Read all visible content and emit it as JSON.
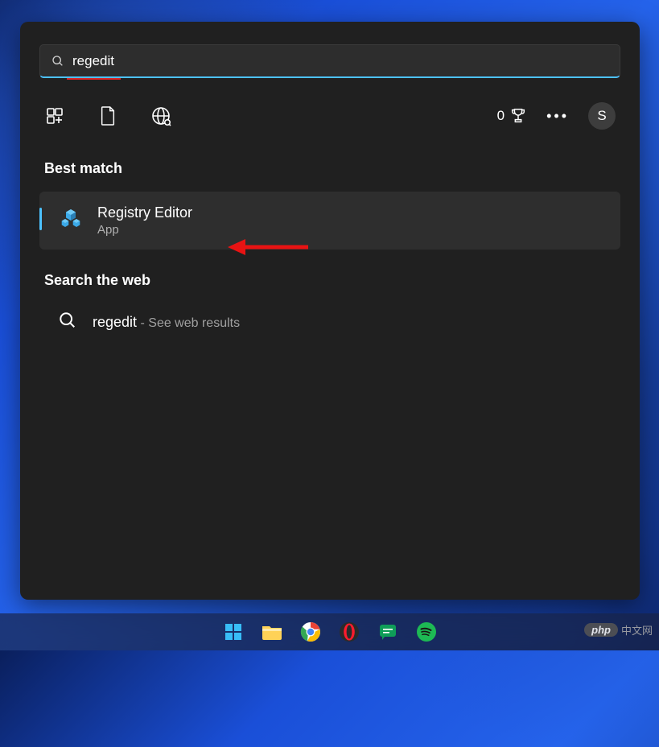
{
  "search": {
    "value": "regedit"
  },
  "rewards": {
    "points": "0"
  },
  "avatar": {
    "initial": "S"
  },
  "sections": {
    "best_match": "Best match",
    "search_web": "Search the web"
  },
  "result": {
    "title": "Registry Editor",
    "subtitle": "App"
  },
  "web": {
    "term": "regedit",
    "suffix": " - See web results"
  },
  "watermark": {
    "badge": "php",
    "text": "中文网"
  }
}
